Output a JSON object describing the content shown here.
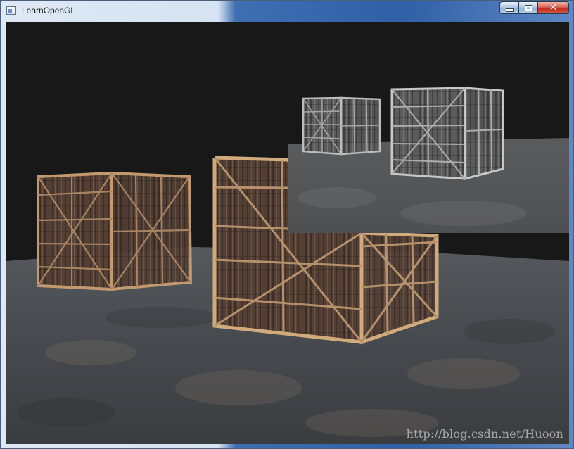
{
  "window": {
    "title": "LearnOpenGL",
    "icon": "window-icon",
    "controls": {
      "minimize": "minimize-icon",
      "maximize": "maximize-icon",
      "close": "close-icon"
    }
  },
  "watermark": {
    "text": "http://blog.csdn.net/Huoon"
  }
}
